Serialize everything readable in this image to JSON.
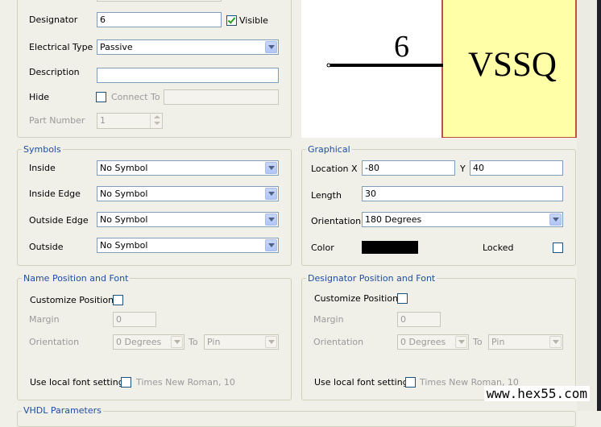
{
  "properties": {
    "designator_label": "Designator",
    "designator_value": "6",
    "visible_label": "Visible",
    "electrical_type_label": "Electrical Type",
    "electrical_type_value": "Passive",
    "description_label": "Description",
    "description_value": "",
    "hide_label": "Hide",
    "connect_to_label": "Connect To",
    "connect_to_value": "",
    "part_number_label": "Part Number",
    "part_number_value": "1"
  },
  "preview": {
    "pin_number": "6",
    "component_name": "VSSQ",
    "body_color": "#ffffa8",
    "body_border_color": "#a81818"
  },
  "symbols": {
    "title": "Symbols",
    "inside_label": "Inside",
    "inside_value": "No Symbol",
    "inside_edge_label": "Inside Edge",
    "inside_edge_value": "No Symbol",
    "outside_edge_label": "Outside Edge",
    "outside_edge_value": "No Symbol",
    "outside_label": "Outside",
    "outside_value": "No Symbol"
  },
  "graphical": {
    "title": "Graphical",
    "location_label": "Location",
    "x_label": "X",
    "x_value": "-80",
    "y_label": "Y",
    "y_value": "40",
    "length_label": "Length",
    "length_value": "30",
    "orientation_label": "Orientation",
    "orientation_value": "180 Degrees",
    "color_label": "Color",
    "color_value": "#000000",
    "locked_label": "Locked"
  },
  "name_position": {
    "title": "Name Position and Font",
    "customize_label": "Customize Position",
    "margin_label": "Margin",
    "margin_value": "0",
    "orientation_label": "Orientation",
    "orientation_value": "0 Degrees",
    "to_label": "To",
    "to_value": "Pin",
    "font_label": "Use local font setting",
    "font_value": "Times New Roman, 10"
  },
  "designator_position": {
    "title": "Designator Position and Font",
    "customize_label": "Customize Position",
    "margin_label": "Margin",
    "margin_value": "0",
    "orientation_label": "Orientation",
    "orientation_value": "0 Degrees",
    "to_label": "To",
    "to_value": "Pin",
    "font_label": "Use local font setting",
    "font_value": "Times New Roman, 10"
  },
  "vhdl": {
    "title": "VHDL Parameters"
  },
  "watermark": "www.hex55.com"
}
